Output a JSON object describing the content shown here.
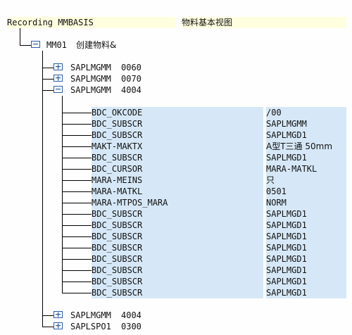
{
  "header": {
    "recording_label": "Recording MMBASIS",
    "description": "物料基本视图"
  },
  "tree": {
    "root": {
      "code": "MM01",
      "label": "创建物料&"
    },
    "programs": [
      {
        "name": "SAPLMGMM",
        "screen": "0060"
      },
      {
        "name": "SAPLMGMM",
        "screen": "0070"
      },
      {
        "name": "SAPLMGMM",
        "screen": "4004"
      }
    ],
    "fields": [
      {
        "name": "BDC_OKCODE",
        "value": "/00"
      },
      {
        "name": "BDC_SUBSCR",
        "value": "SAPLMGMM"
      },
      {
        "name": "BDC_SUBSCR",
        "value": "SAPLMGD1"
      },
      {
        "name": "MAKT-MAKTX",
        "value": "A型T三通 50mm"
      },
      {
        "name": "BDC_SUBSCR",
        "value": "SAPLMGD1"
      },
      {
        "name": "BDC_CURSOR",
        "value": "MARA-MATKL"
      },
      {
        "name": "MARA-MEINS",
        "value": "只"
      },
      {
        "name": "MARA-MATKL",
        "value": "0501"
      },
      {
        "name": "MARA-MTPOS_MARA",
        "value": "NORM"
      },
      {
        "name": "BDC_SUBSCR",
        "value": "SAPLMGD1"
      },
      {
        "name": "BDC_SUBSCR",
        "value": "SAPLMGD1"
      },
      {
        "name": "BDC_SUBSCR",
        "value": "SAPLMGD1"
      },
      {
        "name": "BDC_SUBSCR",
        "value": "SAPLMGD1"
      },
      {
        "name": "BDC_SUBSCR",
        "value": "SAPLMGD1"
      },
      {
        "name": "BDC_SUBSCR",
        "value": "SAPLMGD1"
      },
      {
        "name": "BDC_SUBSCR",
        "value": "SAPLMGD1"
      },
      {
        "name": "BDC_SUBSCR",
        "value": "SAPLMGD1"
      }
    ],
    "trailing_programs": [
      {
        "name": "SAPLMGMM",
        "screen": "4004"
      },
      {
        "name": "SAPLSPO1",
        "screen": "0300"
      }
    ]
  },
  "colors": {
    "header_highlight": "#ffffe0",
    "field_highlight": "#d6e8f7",
    "icon_blue": "#2a5ea8"
  },
  "icons": {
    "folder_open": "folder-open-icon",
    "folder_closed": "folder-closed-icon"
  }
}
